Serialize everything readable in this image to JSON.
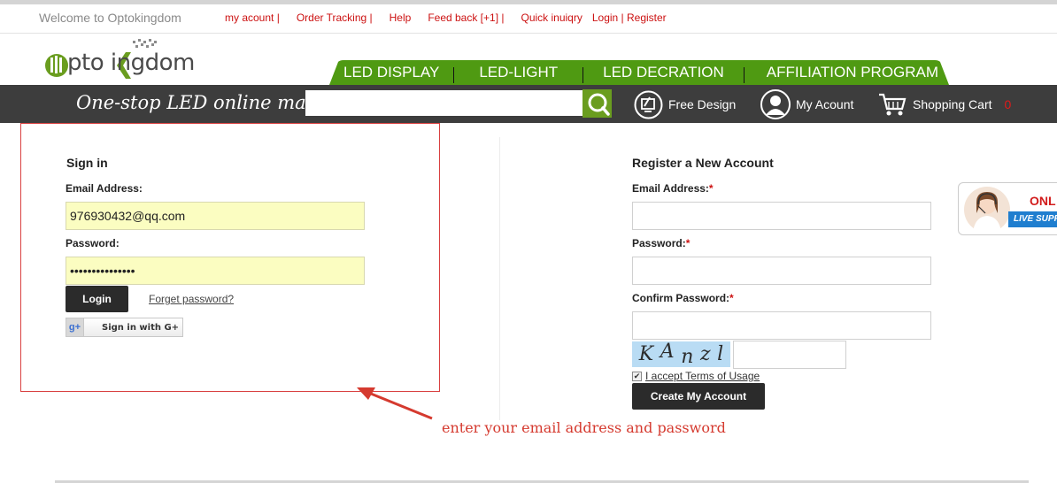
{
  "header": {
    "welcome": "Welcome to Optokingdom",
    "links": [
      {
        "label": "my acount |"
      },
      {
        "label": "Order Tracking |"
      },
      {
        "label": "Help"
      },
      {
        "label": "Feed back [+1] |"
      },
      {
        "label": "Quick inuiqry"
      },
      {
        "label": "Login | Register"
      }
    ]
  },
  "logo": {
    "text": "pto ingdom"
  },
  "nav": {
    "items": [
      "LED DISPLAY",
      "LED-LIGHT",
      "LED DECRATION",
      "AFFILIATION PROGRAM"
    ]
  },
  "bar": {
    "slogan": "One-stop LED online mall",
    "search_value": "",
    "free_design": "Free Design",
    "my_account": "My Acount",
    "cart_label": "Shopping Cart",
    "cart_count": "0"
  },
  "signin": {
    "title": "Sign in",
    "email_label": "Email Address:",
    "email_value": "976930432@qq.com",
    "password_label": "Password:",
    "password_value": "•••••••••••••••",
    "login_button": "Login",
    "forget_link": "Forget password?",
    "gplus_button": "Sign in with G+"
  },
  "register": {
    "title": "Register a New Account",
    "email_label": "Email Address:",
    "password_label": "Password:",
    "confirm_label": "Confirm Password:",
    "required_mark": "*",
    "captcha": [
      "K",
      "A",
      "n",
      "z",
      "l"
    ],
    "terms": "I accept Terms of Usage",
    "terms_checked": true,
    "create_button": "Create My Account"
  },
  "live_support": {
    "online": "ONL",
    "text": "LIVE SUPP"
  },
  "annotation": "enter your email address and password",
  "colors": {
    "accent_green": "#6a9d1f",
    "dark_bar": "#3d3d3d",
    "link_red": "#cc1111"
  }
}
